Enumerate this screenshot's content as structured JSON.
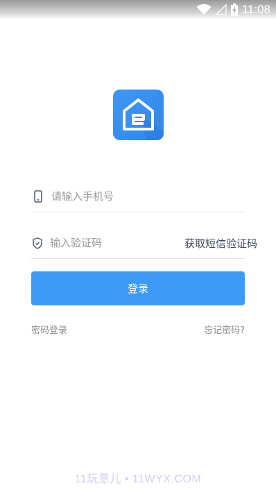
{
  "status_bar": {
    "time": "11:08",
    "icons": [
      "wifi-icon",
      "signal-icon",
      "battery-charging-icon"
    ]
  },
  "colors": {
    "accent": "#3d9bf7",
    "logo_bg": "#3a8ff0",
    "link_dark": "#3f4a6a",
    "muted_text": "#8c8c8c"
  },
  "login_form": {
    "phone_placeholder": "请输入手机号",
    "code_placeholder": "输入验证码",
    "get_code_label": "获取短信验证码",
    "submit_label": "登录"
  },
  "links": {
    "password_login": "密码登录",
    "forgot_password": "忘记密码?"
  },
  "watermark": "11玩意儿 • 11WYX.COM"
}
